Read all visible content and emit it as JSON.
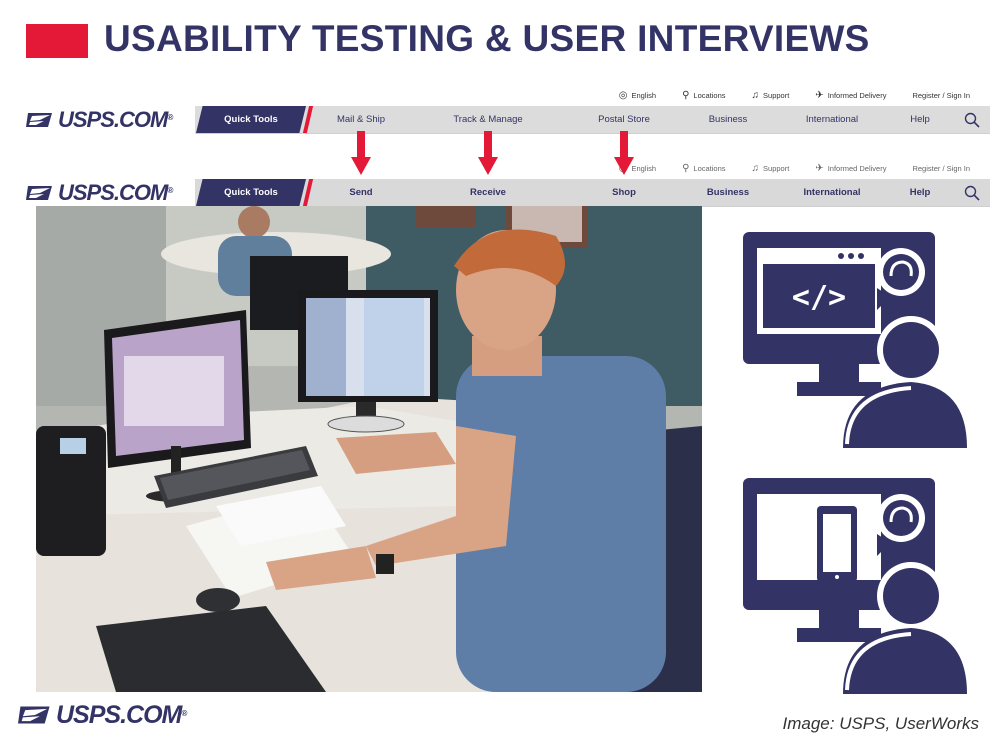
{
  "slide": {
    "title": "USABILITY TESTING & USER INTERVIEWS",
    "credit": "Image: USPS, UserWorks",
    "accent_red": "#e31937",
    "navy": "#333366"
  },
  "logo": {
    "text": "USPS.COM",
    "reg": "®"
  },
  "nav_before": {
    "utility": [
      {
        "icon": "globe-icon",
        "label": "English"
      },
      {
        "icon": "location-pin-icon",
        "label": "Locations"
      },
      {
        "icon": "headset-icon",
        "label": "Support"
      },
      {
        "icon": "informed-delivery-icon",
        "label": "Informed Delivery"
      },
      {
        "icon": "",
        "label": "Register / Sign In"
      }
    ],
    "quick_tools": "Quick Tools",
    "items": [
      "Mail & Ship",
      "Track & Manage",
      "Postal Store",
      "Business",
      "International",
      "Help"
    ]
  },
  "nav_after": {
    "utility": [
      {
        "icon": "globe-icon",
        "label": "English"
      },
      {
        "icon": "location-pin-icon",
        "label": "Locations"
      },
      {
        "icon": "headset-icon",
        "label": "Support"
      },
      {
        "icon": "informed-delivery-icon",
        "label": "Informed Delivery"
      },
      {
        "icon": "",
        "label": "Register / Sign In"
      }
    ],
    "quick_tools": "Quick Tools",
    "items": [
      "Send",
      "Receive",
      "Shop",
      "Business",
      "International",
      "Help"
    ]
  }
}
